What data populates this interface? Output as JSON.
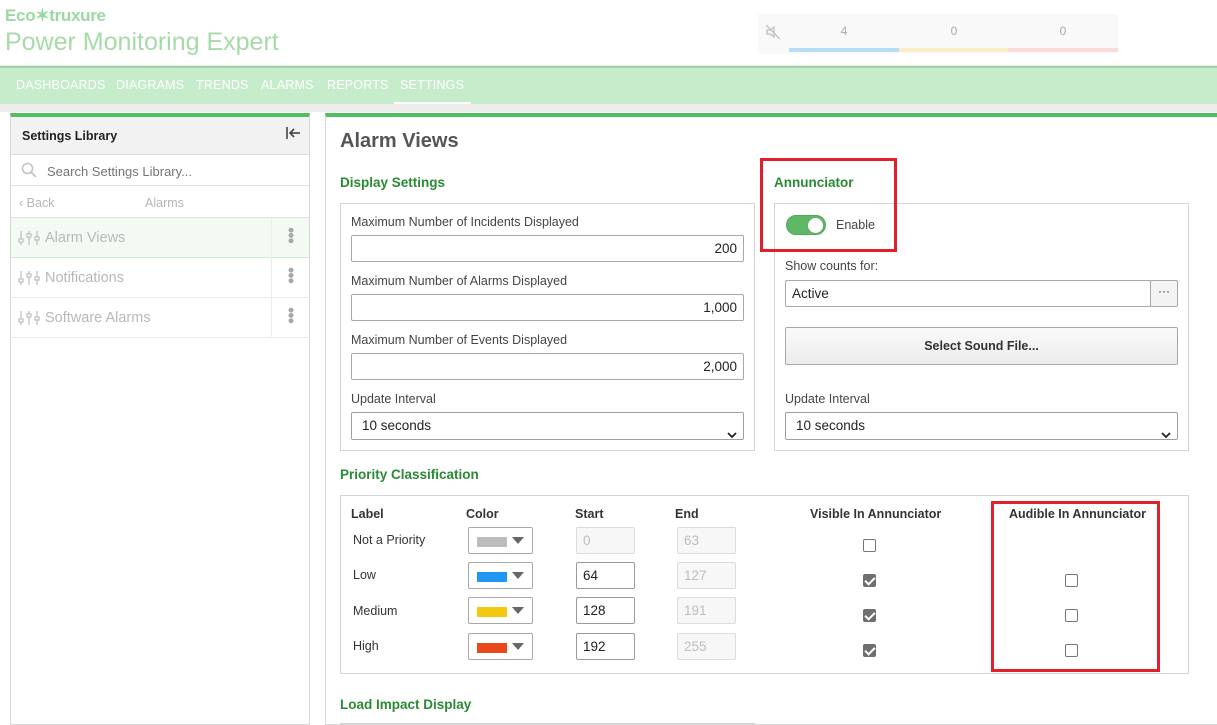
{
  "brand": {
    "logo_text": "Eco✶truxure",
    "product": "Power Monitoring Expert"
  },
  "header": {
    "mute_icon": "speaker-muted-icon",
    "counters": [
      {
        "value": "4",
        "color": "#b9dcf5"
      },
      {
        "value": "0",
        "color": "#fbeec7"
      },
      {
        "value": "0",
        "color": "#f9dcd8"
      }
    ]
  },
  "nav": {
    "tabs": [
      {
        "label": "DASHBOARDS"
      },
      {
        "label": "DIAGRAMS"
      },
      {
        "label": "TRENDS"
      },
      {
        "label": "ALARMS"
      },
      {
        "label": "REPORTS"
      },
      {
        "label": "SETTINGS",
        "active": true
      }
    ]
  },
  "sidebar": {
    "title": "Settings Library",
    "search_placeholder": "Search Settings Library...",
    "back_label": "Back",
    "current_folder": "Alarms",
    "items": [
      {
        "label": "Alarm Views",
        "active": true
      },
      {
        "label": "Notifications"
      },
      {
        "label": "Software Alarms"
      }
    ]
  },
  "main": {
    "title": "Alarm Views",
    "display_settings": {
      "title": "Display Settings",
      "incidents_label": "Maximum Number of Incidents Displayed",
      "incidents_value": "200",
      "alarms_label": "Maximum Number of Alarms Displayed",
      "alarms_value": "1,000",
      "events_label": "Maximum Number of Events Displayed",
      "events_value": "2,000",
      "interval_label": "Update Interval",
      "interval_value": "10 seconds"
    },
    "annunciator": {
      "title": "Annunciator",
      "enable_label": "Enable",
      "enabled": true,
      "show_counts_label": "Show counts for:",
      "show_counts_value": "Active",
      "ellipsis_label": "···",
      "sound_button": "Select Sound File...",
      "interval_label": "Update Interval",
      "interval_value": "10 seconds"
    },
    "priority": {
      "title": "Priority Classification",
      "headers": {
        "label": "Label",
        "color": "Color",
        "start": "Start",
        "end": "End",
        "visible": "Visible In Annunciator",
        "audible": "Audible In Annunciator"
      },
      "rows": [
        {
          "label": "Not a Priority",
          "color": "#bdbdbd",
          "start": "0",
          "end": "63",
          "start_disabled": true,
          "visible": false,
          "audible": null
        },
        {
          "label": "Low",
          "color": "#2196f3",
          "start": "64",
          "end": "127",
          "start_disabled": false,
          "visible": true,
          "audible": false
        },
        {
          "label": "Medium",
          "color": "#f2c811",
          "start": "128",
          "end": "191",
          "start_disabled": false,
          "visible": true,
          "audible": false
        },
        {
          "label": "High",
          "color": "#e8491d",
          "start": "192",
          "end": "255",
          "start_disabled": false,
          "visible": true,
          "audible": false
        }
      ]
    },
    "load_impact": {
      "title": "Load Impact Display"
    }
  },
  "colors": {
    "accent": "#4fc05c",
    "section_title": "#2a8a34",
    "highlight": "#e0202a"
  }
}
